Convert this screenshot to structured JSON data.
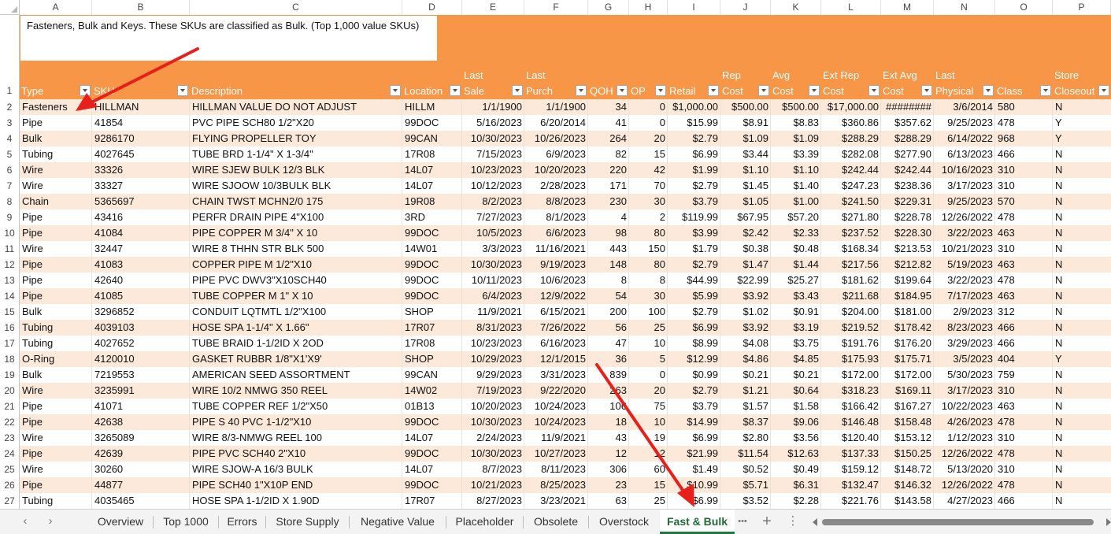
{
  "columns": [
    "A",
    "B",
    "C",
    "D",
    "E",
    "F",
    "G",
    "H",
    "I",
    "J",
    "K",
    "L",
    "M",
    "N",
    "O",
    "P"
  ],
  "note": "Fasteners, Bulk and Keys.  These SKUs are classified as Bulk. (Top 1,000 value SKUs)",
  "header_row_number": "1",
  "headers": [
    {
      "l1": "",
      "l2": "Type"
    },
    {
      "l1": "",
      "l2": "SKU"
    },
    {
      "l1": "",
      "l2": "Description"
    },
    {
      "l1": "",
      "l2": "Location"
    },
    {
      "l1": "Last",
      "l2": "Sale"
    },
    {
      "l1": "Last",
      "l2": "Purch"
    },
    {
      "l1": "",
      "l2": "QOH"
    },
    {
      "l1": "",
      "l2": "OP"
    },
    {
      "l1": "",
      "l2": "Retail"
    },
    {
      "l1": "Rep",
      "l2": "Cost"
    },
    {
      "l1": "Avg",
      "l2": "Cost"
    },
    {
      "l1": "Ext Rep",
      "l2": "Cost"
    },
    {
      "l1": "Ext Avg",
      "l2": "Cost"
    },
    {
      "l1": "Last",
      "l2": "Physical"
    },
    {
      "l1": "",
      "l2": "Class"
    },
    {
      "l1": "Store",
      "l2": "Closeout"
    }
  ],
  "rows": [
    {
      "n": "2",
      "c": [
        "Fasteners",
        "HILLMAN",
        "HILLMAN VALUE DO NOT ADJUST",
        "HILLM",
        "1/1/1900",
        "1/1/1900",
        "34",
        "0",
        "$1,000.00",
        "$500.00",
        "$500.00",
        "$17,000.00",
        "########",
        "3/6/2014",
        "580",
        "N"
      ]
    },
    {
      "n": "3",
      "c": [
        "Pipe",
        "41854",
        "PVC PIPE SCH80 1/2\"X20",
        "99DOC",
        "5/16/2023",
        "6/20/2014",
        "41",
        "0",
        "$15.99",
        "$8.91",
        "$8.83",
        "$360.86",
        "$357.62",
        "9/25/2023",
        "478",
        "Y"
      ]
    },
    {
      "n": "4",
      "c": [
        "Bulk",
        "9286170",
        "FLYING PROPELLER TOY",
        "99CAN",
        "10/30/2023",
        "10/26/2023",
        "264",
        "20",
        "$2.79",
        "$1.09",
        "$1.09",
        "$288.29",
        "$288.29",
        "6/14/2022",
        "968",
        "Y"
      ]
    },
    {
      "n": "5",
      "c": [
        "Tubing",
        "4027645",
        "TUBE BRD 1-1/4\" X 1-3/4\"",
        "17R08",
        "7/15/2023",
        "6/9/2023",
        "82",
        "15",
        "$6.99",
        "$3.44",
        "$3.39",
        "$282.08",
        "$277.90",
        "6/13/2023",
        "466",
        "N"
      ]
    },
    {
      "n": "6",
      "c": [
        "Wire",
        "33326",
        "WIRE SJEW BULK 12/3 BLK",
        "14L07",
        "10/23/2023",
        "10/20/2023",
        "220",
        "42",
        "$1.99",
        "$1.10",
        "$1.10",
        "$242.44",
        "$242.44",
        "10/16/2023",
        "310",
        "N"
      ]
    },
    {
      "n": "7",
      "c": [
        "Wire",
        "33327",
        "WIRE SJOOW 10/3BULK BLK",
        "14L07",
        "10/12/2023",
        "2/28/2023",
        "171",
        "70",
        "$2.79",
        "$1.45",
        "$1.40",
        "$247.23",
        "$238.36",
        "3/17/2023",
        "310",
        "N"
      ]
    },
    {
      "n": "8",
      "c": [
        "Chain",
        "5365697",
        "CHAIN TWST MCHN2/0 175",
        "19R08",
        "8/2/2023",
        "8/8/2023",
        "230",
        "30",
        "$3.79",
        "$1.05",
        "$1.00",
        "$241.50",
        "$229.31",
        "9/25/2023",
        "570",
        "N"
      ]
    },
    {
      "n": "9",
      "c": [
        "Pipe",
        "43416",
        "PERFR DRAIN PIPE 4\"X100",
        "3RD",
        "7/27/2023",
        "8/1/2023",
        "4",
        "2",
        "$119.99",
        "$67.95",
        "$57.20",
        "$271.80",
        "$228.78",
        "12/26/2022",
        "478",
        "N"
      ]
    },
    {
      "n": "10",
      "c": [
        "Pipe",
        "41084",
        "PIPE COPPER M 3/4\" X 10",
        "99DOC",
        "10/5/2023",
        "6/6/2023",
        "98",
        "80",
        "$3.99",
        "$2.42",
        "$2.33",
        "$237.52",
        "$228.30",
        "3/22/2023",
        "463",
        "N"
      ]
    },
    {
      "n": "11",
      "c": [
        "Wire",
        "32447",
        "WIRE 8 THHN STR BLK 500",
        "14W01",
        "3/3/2023",
        "11/16/2021",
        "443",
        "150",
        "$1.79",
        "$0.38",
        "$0.48",
        "$168.34",
        "$213.53",
        "10/21/2023",
        "310",
        "N"
      ]
    },
    {
      "n": "12",
      "c": [
        "Pipe",
        "41083",
        "COPPER PIPE M 1/2\"X10",
        "99DOC",
        "10/30/2023",
        "9/19/2023",
        "148",
        "80",
        "$2.79",
        "$1.47",
        "$1.44",
        "$217.56",
        "$212.82",
        "5/19/2023",
        "463",
        "N"
      ]
    },
    {
      "n": "13",
      "c": [
        "Pipe",
        "42640",
        "PIPE PVC DWV3\"X10SCH40",
        "99DOC",
        "10/11/2023",
        "10/6/2023",
        "8",
        "8",
        "$44.99",
        "$22.99",
        "$25.27",
        "$181.62",
        "$199.64",
        "3/22/2023",
        "478",
        "N"
      ]
    },
    {
      "n": "14",
      "c": [
        "Pipe",
        "41085",
        "TUBE COPPER M 1\" X 10",
        "99DOC",
        "6/4/2023",
        "12/9/2022",
        "54",
        "30",
        "$5.99",
        "$3.92",
        "$3.43",
        "$211.68",
        "$184.95",
        "7/17/2023",
        "463",
        "N"
      ]
    },
    {
      "n": "15",
      "c": [
        "Bulk",
        "3296852",
        "CONDUIT LQTMTL 1/2\"X100",
        "SHOP",
        "11/9/2021",
        "6/15/2021",
        "200",
        "100",
        "$2.79",
        "$1.02",
        "$0.91",
        "$204.00",
        "$181.00",
        "2/9/2023",
        "312",
        "N"
      ]
    },
    {
      "n": "16",
      "c": [
        "Tubing",
        "4039103",
        "HOSE SPA 1-1/4\" X 1.66\"",
        "17R07",
        "8/31/2023",
        "7/26/2022",
        "56",
        "25",
        "$6.99",
        "$3.92",
        "$3.19",
        "$219.52",
        "$178.42",
        "8/23/2023",
        "466",
        "N"
      ]
    },
    {
      "n": "17",
      "c": [
        "Tubing",
        "4027652",
        "TUBE BRAID 1-1/2ID X 2OD",
        "17R08",
        "10/23/2023",
        "6/16/2023",
        "47",
        "10",
        "$8.99",
        "$4.08",
        "$3.75",
        "$191.76",
        "$176.20",
        "3/29/2023",
        "466",
        "N"
      ]
    },
    {
      "n": "18",
      "c": [
        "O-Ring",
        "4120010",
        "GASKET RUBBR 1/8\"X1'X9'",
        "SHOP",
        "10/29/2023",
        "12/1/2015",
        "36",
        "5",
        "$12.99",
        "$4.86",
        "$4.85",
        "$175.93",
        "$175.71",
        "3/5/2023",
        "404",
        "Y"
      ]
    },
    {
      "n": "19",
      "c": [
        "Bulk",
        "7219553",
        "AMERICAN SEED ASSORTMENT",
        "99CAN",
        "9/29/2023",
        "3/31/2023",
        "839",
        "0",
        "$0.99",
        "$0.21",
        "$0.21",
        "$172.00",
        "$172.00",
        "5/30/2023",
        "759",
        "N"
      ]
    },
    {
      "n": "20",
      "c": [
        "Wire",
        "3235991",
        "WIRE 10/2 NMWG 350 REEL",
        "14W02",
        "7/19/2023",
        "9/22/2020",
        "263",
        "20",
        "$2.79",
        "$1.21",
        "$0.64",
        "$318.23",
        "$169.11",
        "3/17/2023",
        "310",
        "N"
      ]
    },
    {
      "n": "21",
      "c": [
        "Pipe",
        "41071",
        "TUBE COPPER REF 1/2\"X50",
        "01B13",
        "10/20/2023",
        "10/24/2023",
        "106",
        "75",
        "$3.79",
        "$1.57",
        "$1.58",
        "$166.42",
        "$167.27",
        "10/22/2023",
        "463",
        "N"
      ]
    },
    {
      "n": "22",
      "c": [
        "Pipe",
        "42638",
        "PIPE S 40 PVC 1-1/2\"X10",
        "99DOC",
        "10/30/2023",
        "10/24/2023",
        "18",
        "10",
        "$14.99",
        "$8.37",
        "$9.06",
        "$146.48",
        "$158.48",
        "4/26/2023",
        "478",
        "N"
      ]
    },
    {
      "n": "23",
      "c": [
        "Wire",
        "3265089",
        "WIRE 8/3-NMWG REEL 100",
        "14L07",
        "2/24/2023",
        "11/9/2021",
        "43",
        "19",
        "$6.99",
        "$2.80",
        "$3.56",
        "$120.40",
        "$153.12",
        "1/12/2023",
        "310",
        "N"
      ]
    },
    {
      "n": "24",
      "c": [
        "Pipe",
        "42639",
        "PIPE PVC SCH40 2\"X10",
        "99DOC",
        "10/30/2023",
        "10/27/2023",
        "12",
        "12",
        "$21.99",
        "$11.54",
        "$12.63",
        "$137.33",
        "$150.25",
        "12/26/2022",
        "478",
        "N"
      ]
    },
    {
      "n": "25",
      "c": [
        "Wire",
        "30260",
        "WIRE SJOW-A 16/3 BULK",
        "14L07",
        "8/7/2023",
        "8/11/2023",
        "306",
        "60",
        "$1.49",
        "$0.52",
        "$0.49",
        "$159.12",
        "$148.72",
        "5/13/2020",
        "310",
        "N"
      ]
    },
    {
      "n": "26",
      "c": [
        "Pipe",
        "44877",
        "PIPE SCH40 1\"X10P END",
        "99DOC",
        "10/21/2023",
        "8/25/2023",
        "23",
        "15",
        "$10.99",
        "$5.71",
        "$6.31",
        "$132.47",
        "$146.32",
        "12/26/2022",
        "478",
        "N"
      ]
    },
    {
      "n": "27",
      "c": [
        "Tubing",
        "4035465",
        "HOSE SPA 1-1/2ID X 1.90D",
        "17R07",
        "8/27/2023",
        "3/23/2021",
        "63",
        "25",
        "$6.99",
        "$3.52",
        "$2.28",
        "$221.76",
        "$143.58",
        "4/27/2023",
        "466",
        "N"
      ]
    }
  ],
  "tabs": [
    "Overview",
    "Top 1000",
    "Errors",
    "Store Supply",
    "Negative Value",
    "Placeholder",
    "Obsolete",
    "Overstock",
    "Fast & Bulk"
  ],
  "active_tab": "Fast & Bulk",
  "tab_controls": {
    "more": "•••",
    "add": "+",
    "options": "⋮",
    "prev": "‹",
    "next": "›"
  },
  "icons": {
    "prev": "chevron-left-icon",
    "next": "chevron-right-icon",
    "more": "ellipsis-icon",
    "add": "plus-icon",
    "options": "vertical-dots-icon",
    "arrow": "red-arrow-annotation"
  },
  "colors": {
    "header_band": "#f79646",
    "band_row": "#fde9d9",
    "active_tab": "#1e7b3c",
    "arrow": "#e8201c"
  }
}
